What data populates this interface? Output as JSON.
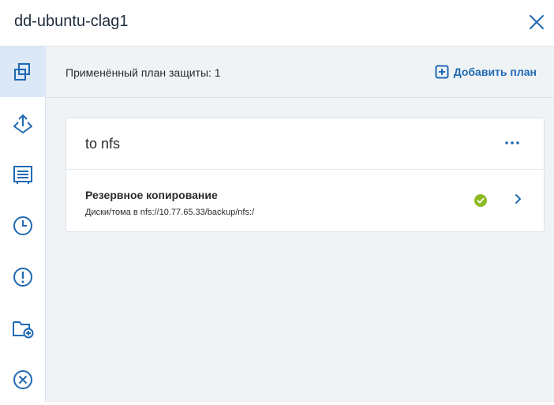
{
  "header": {
    "title": "dd-ubuntu-clag1",
    "close_icon": "close-icon"
  },
  "sidebar": {
    "items": [
      {
        "icon": "protection-plans-icon",
        "active": true
      },
      {
        "icon": "recovery-icon",
        "active": false
      },
      {
        "icon": "activities-icon",
        "active": false
      },
      {
        "icon": "history-icon",
        "active": false
      },
      {
        "icon": "alerts-icon",
        "active": false
      },
      {
        "icon": "folder-add-icon",
        "active": false
      },
      {
        "icon": "remove-icon",
        "active": false
      }
    ]
  },
  "plans_bar": {
    "applied_label": "Применённый план защиты: 1",
    "add_plan_label": "Добавить план"
  },
  "plan_card": {
    "title": "to nfs",
    "menu_icon": "more-dots-icon",
    "rows": [
      {
        "title": "Резервное копирование",
        "subtitle": "Диски/тома в nfs://10.77.65.33/backup/nfs:/",
        "status_icon": "check-circle-icon"
      }
    ]
  },
  "colors": {
    "accent": "#1f69b3",
    "active_sidebar": "#dce8f5",
    "status_ok": "#8cbb24",
    "background": "#f0f3f6"
  }
}
